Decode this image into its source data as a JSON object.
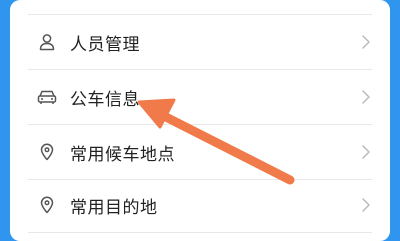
{
  "menu": {
    "items": [
      {
        "label": "人员管理",
        "icon": "person-icon"
      },
      {
        "label": "公车信息",
        "icon": "car-icon"
      },
      {
        "label": "常用候车地点",
        "icon": "location-pin-icon"
      },
      {
        "label": "常用目的地",
        "icon": "location-pin-icon"
      }
    ]
  },
  "annotation": {
    "arrow_color": "#f07a4a",
    "target": "公车信息"
  },
  "colors": {
    "background": "#2f95ef",
    "card": "#ffffff",
    "text": "#222222",
    "icon": "#555555",
    "chevron": "#bbbbbb",
    "divider": "#e8e8e8"
  }
}
